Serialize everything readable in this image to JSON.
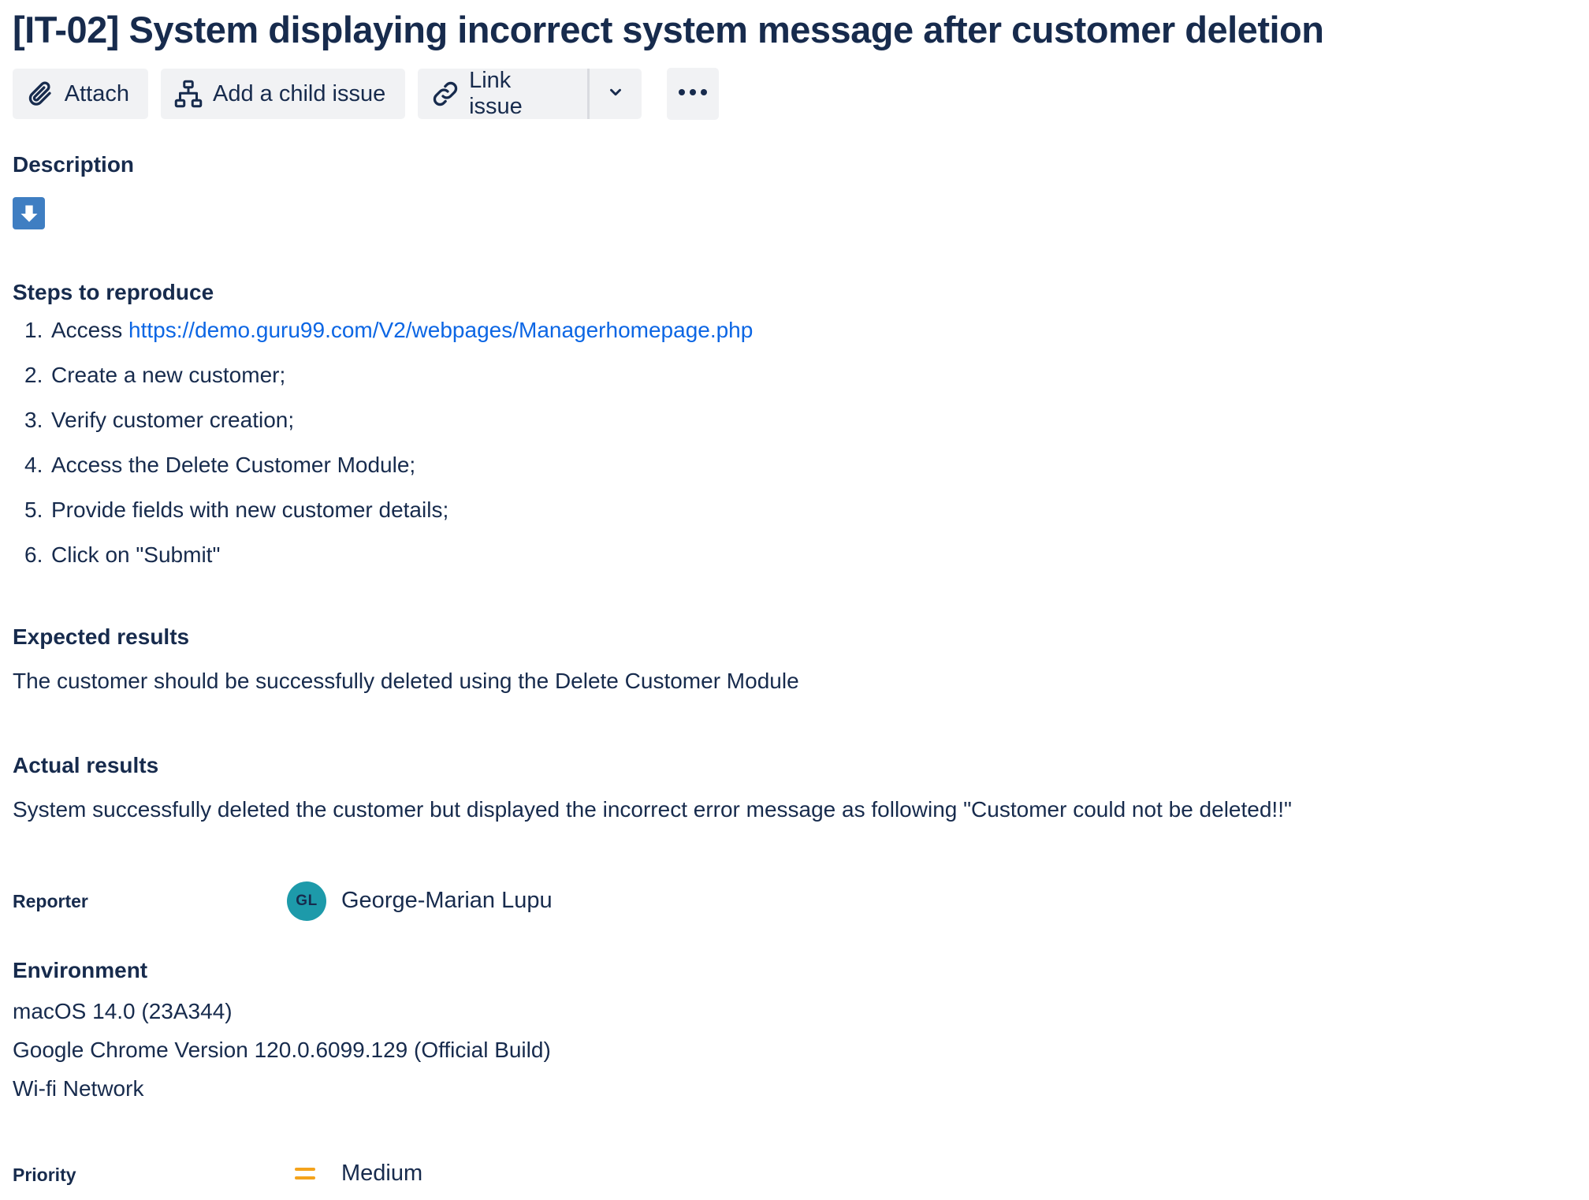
{
  "issue": {
    "title": "[IT-02] System displaying incorrect system message after customer deletion"
  },
  "toolbar": {
    "attach_label": "Attach",
    "attach_icon": "paperclip-icon",
    "child_label": "Add a child issue",
    "child_icon": "hierarchy-icon",
    "link_label": "Link issue",
    "link_icon": "link-icon",
    "dropdown_icon": "chevron-down-icon",
    "more_icon": "more-horizontal-icon"
  },
  "description": {
    "heading": "Description",
    "download_icon": "download-arrow-icon"
  },
  "steps": {
    "heading": "Steps to reproduce",
    "items": [
      {
        "num": "1.",
        "text": "Access ",
        "link": "https://demo.guru99.com/V2/webpages/Managerhomepage.php"
      },
      {
        "num": "2.",
        "text": "Create a new customer;"
      },
      {
        "num": "3.",
        "text": "Verify customer creation;"
      },
      {
        "num": "4.",
        "text": "Access the Delete Customer Module;"
      },
      {
        "num": "5.",
        "text": "Provide fields with new customer details;"
      },
      {
        "num": "6.",
        "text": "Click on \"Submit\""
      }
    ]
  },
  "expected": {
    "heading": "Expected results",
    "text": "The customer should be successfully deleted using the Delete Customer Module"
  },
  "actual": {
    "heading": "Actual results",
    "text": "System successfully deleted the customer but displayed the incorrect error message as following \"Customer could not be deleted!!\""
  },
  "reporter": {
    "label": "Reporter",
    "initials": "GL",
    "name": "George-Marian Lupu",
    "avatar_color": "#1d9aaa"
  },
  "environment": {
    "heading": "Environment",
    "lines": [
      "macOS 14.0 (23A344)",
      "Google Chrome Version 120.0.6099.129 (Official Build)",
      "Wi-fi Network"
    ]
  },
  "priority": {
    "label": "Priority",
    "value": "Medium",
    "icon": "priority-medium-icon",
    "icon_color": "#f4a31c"
  },
  "colors": {
    "text": "#172b4d",
    "link": "#0c66e4",
    "button_bg": "#f1f2f4",
    "download_icon_bg": "#3f7ec2"
  }
}
